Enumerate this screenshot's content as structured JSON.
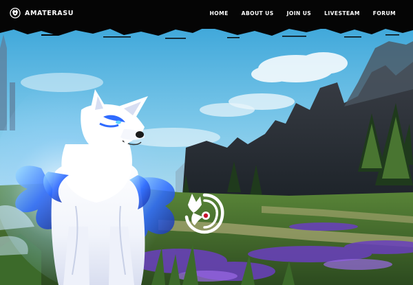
{
  "brand": {
    "name": "AMATERASU",
    "icon": "wolf-logo-icon"
  },
  "nav": {
    "items": [
      {
        "label": "HOME"
      },
      {
        "label": "ABOUT US"
      },
      {
        "label": "JOIN US"
      },
      {
        "label": "LIVESTEAM"
      },
      {
        "label": "FORUM"
      }
    ]
  },
  "hero": {
    "subject": "white spirit wolf with blue flames",
    "emblem_icon": "wolf-emblem-icon"
  },
  "colors": {
    "nav_background": "#050505",
    "nav_text": "#ffffff",
    "sky": "#7ec6e8",
    "accent_blue": "#3a7bff",
    "emblem_red": "#c8102e"
  }
}
